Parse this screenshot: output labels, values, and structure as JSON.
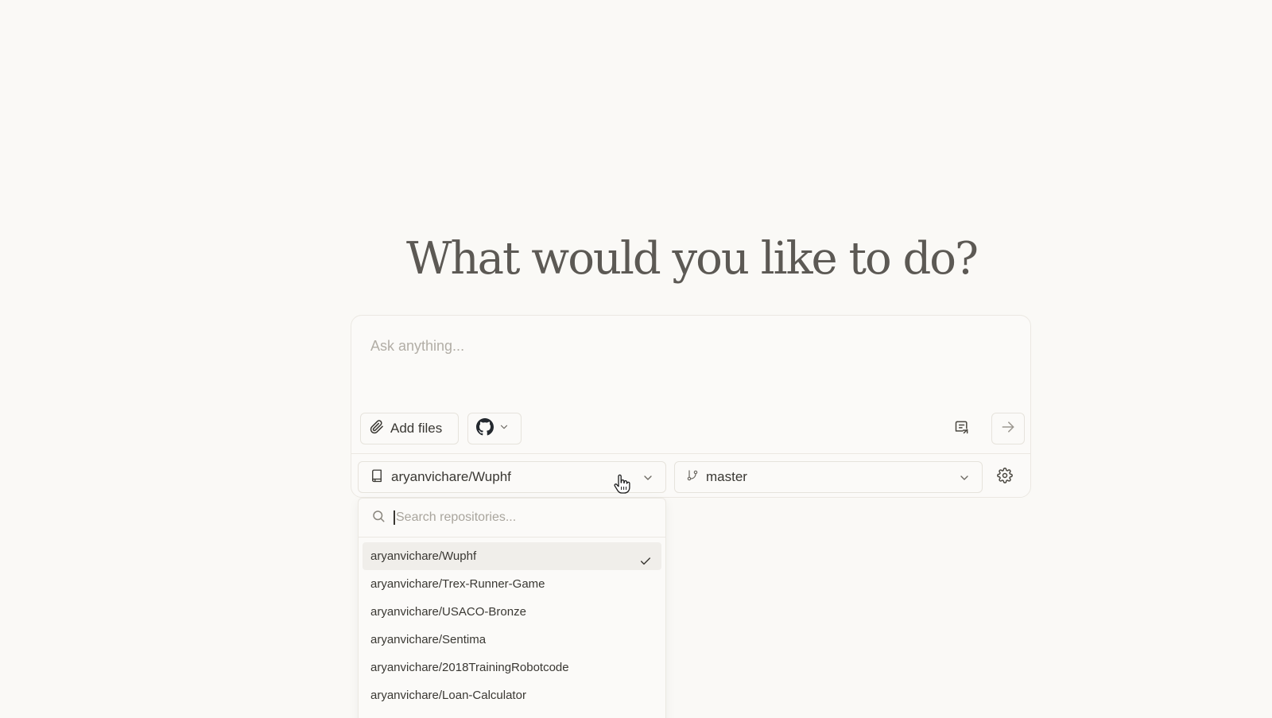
{
  "heading": "What would you like to do?",
  "composer": {
    "placeholder": "Ask anything...",
    "add_files_label": "Add files",
    "github_icon": "github-icon",
    "repo_selected": "aryanvichare/Wuphf",
    "branch_selected": "master"
  },
  "dropdown": {
    "search_placeholder": "Search repositories...",
    "items": [
      {
        "label": "aryanvichare/Wuphf",
        "selected": true
      },
      {
        "label": "aryanvichare/Trex-Runner-Game",
        "selected": false
      },
      {
        "label": "aryanvichare/USACO-Bronze",
        "selected": false
      },
      {
        "label": "aryanvichare/Sentima",
        "selected": false
      },
      {
        "label": "aryanvichare/2018TrainingRobotcode",
        "selected": false
      },
      {
        "label": "aryanvichare/Loan-Calculator",
        "selected": false
      }
    ]
  },
  "colors": {
    "background": "#faf9f6",
    "text": "#3a3833",
    "heading": "#5c5954",
    "border": "#ebe8e2",
    "selected_row": "#f0eeea"
  }
}
